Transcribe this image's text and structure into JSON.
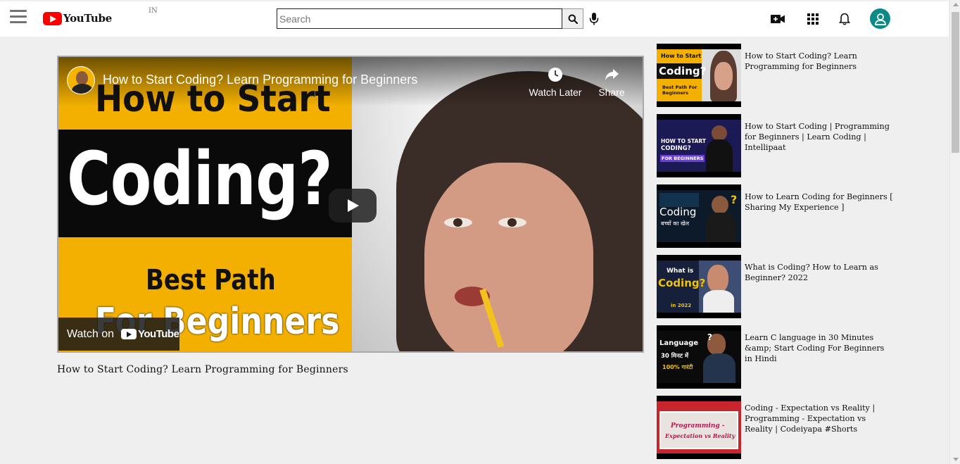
{
  "header": {
    "logo_text": "YouTube",
    "country_code": "IN",
    "search_placeholder": "Search"
  },
  "player": {
    "video_title_overlay": "How to Start Coding? Learn Programming for Beginners",
    "watch_later_label": "Watch Later",
    "share_label": "Share",
    "watch_on_label": "Watch on",
    "watch_on_brand": "YouTube",
    "thumbnail_text": {
      "line1": "How to Start",
      "line2": "Coding?",
      "line3": "Best Path",
      "line4": "For Beginners"
    }
  },
  "video": {
    "title": "How to Start Coding? Learn Programming for Beginners"
  },
  "sidebar": {
    "items": [
      {
        "title": "How to Start Coding? Learn Programming for Beginners",
        "thumb_top": "How to Start",
        "thumb_main": "Coding?",
        "thumb_sub": "Best Path For Beginners"
      },
      {
        "title": "How to Start Coding | Programming for Beginners | Learn Coding | Intellipaat",
        "thumb_top": "HOW TO START",
        "thumb_main": "CODING?",
        "thumb_sub": "FOR BEGINNERS"
      },
      {
        "title": "How to Learn Coding for Beginners [ Sharing My Experience ]",
        "thumb_top": "",
        "thumb_main": "Coding",
        "thumb_sub": "बच्चों का खेल"
      },
      {
        "title": "What is Coding? How to Learn as Beginner? 2022",
        "thumb_top": "What is",
        "thumb_main": "Coding?",
        "thumb_sub": "in 2022"
      },
      {
        "title": "Learn C language in 30 Minutes &amp; Start Coding For Beginners in Hindi",
        "thumb_top": "Language",
        "thumb_main": "30 मिनट में",
        "thumb_sub": "100% गारंटी"
      },
      {
        "title": "Coding - Expectation vs Reality | Programming - Expectation vs Reality | Codeiyapa #Shorts",
        "thumb_top": "",
        "thumb_main": "Programming -",
        "thumb_sub": "Expectation vs Reality"
      }
    ]
  },
  "colors": {
    "brand_red": "#ff0000",
    "avatar_teal": "#0d8a86",
    "thumb_yellow": "#f3b000"
  }
}
